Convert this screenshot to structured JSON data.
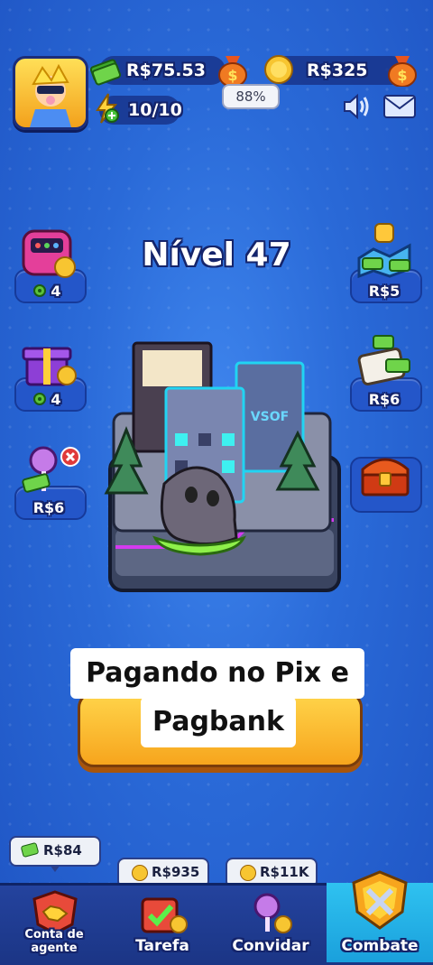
{
  "hud": {
    "money": "R$75.53",
    "money_percent": "88%",
    "coins": "R$325",
    "energy": "10/10"
  },
  "level": {
    "title": "Nível 47"
  },
  "left_widgets": [
    {
      "label": "4"
    },
    {
      "label": "4"
    },
    {
      "label": "R$6"
    }
  ],
  "right_widgets": [
    {
      "label": "R$5"
    },
    {
      "label": "R$6"
    }
  ],
  "caption": {
    "line1": "Pagando no Pix e",
    "line2": "Pagbank"
  },
  "bottom_nav": {
    "agent": {
      "label": "Conta de agente",
      "badge": "R$84"
    },
    "task": {
      "label": "Tarefa",
      "badge": "R$935"
    },
    "invite": {
      "label": "Convidar",
      "badge": "R$11K"
    },
    "combat": {
      "label": "Combate"
    }
  },
  "colors": {
    "accent": "#1aa0dc",
    "gold": "#f7a51d",
    "cash": "#5cc23a"
  }
}
